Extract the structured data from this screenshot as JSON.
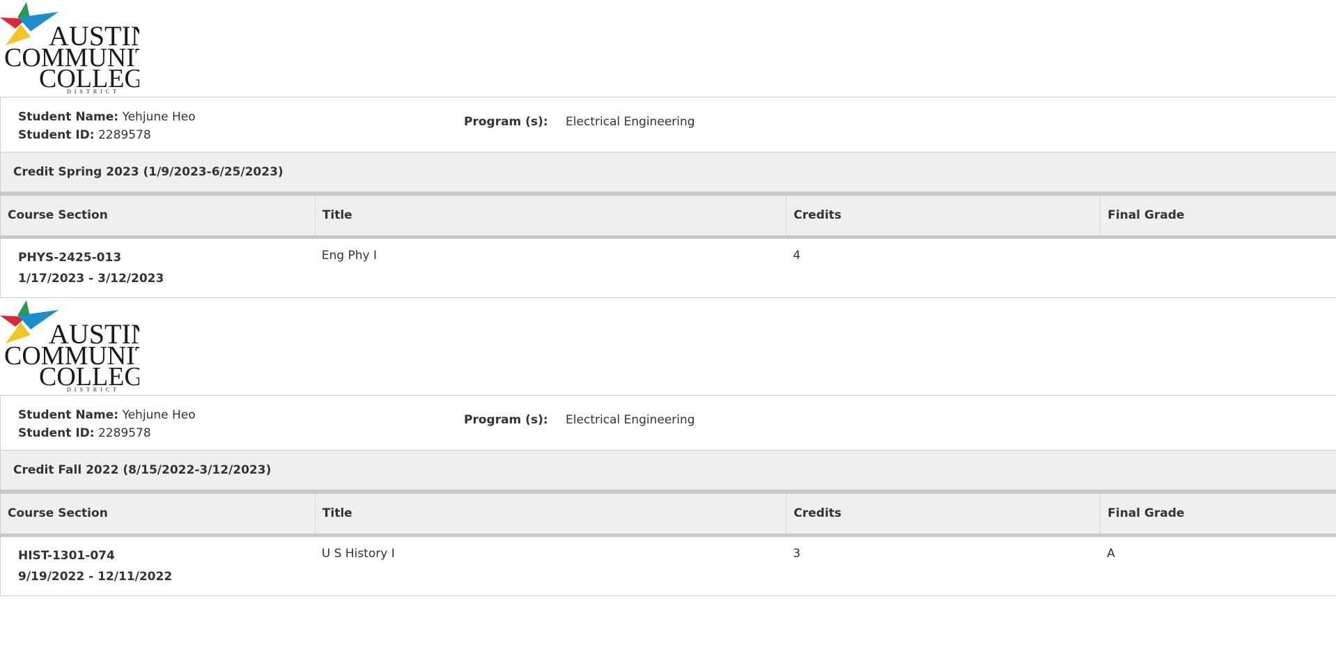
{
  "school": {
    "name_line1": "AUSTIN",
    "name_line2": "COMMUNITY",
    "name_line3": "COLLEGE",
    "name_line4": "DISTRICT",
    "star_colors": [
      "#d62b35",
      "#1b8fce",
      "#f3c623",
      "#2a9a4a"
    ]
  },
  "student": {
    "name_label": "Student Name:",
    "name": "Yehjune Heo",
    "id_label": "Student ID:",
    "id": "2289578",
    "program_label": "Program (s):",
    "program": "Electrical Engineering"
  },
  "columns": {
    "section": "Course Section",
    "title": "Title",
    "credits": "Credits",
    "grade": "Final Grade"
  },
  "terms": [
    {
      "heading": "Credit Spring 2023 (1/9/2023-6/25/2023)",
      "course": {
        "section": "PHYS-2425-013",
        "dates": "1/17/2023 - 3/12/2023",
        "title": "Eng Phy I",
        "credits": "4",
        "grade": ""
      }
    },
    {
      "heading": "Credit Fall 2022 (8/15/2022-3/12/2023)",
      "course": {
        "section": "HIST-1301-074",
        "dates": "9/19/2022 - 12/11/2022",
        "title": "U S History I",
        "credits": "3",
        "grade": "A"
      }
    }
  ]
}
